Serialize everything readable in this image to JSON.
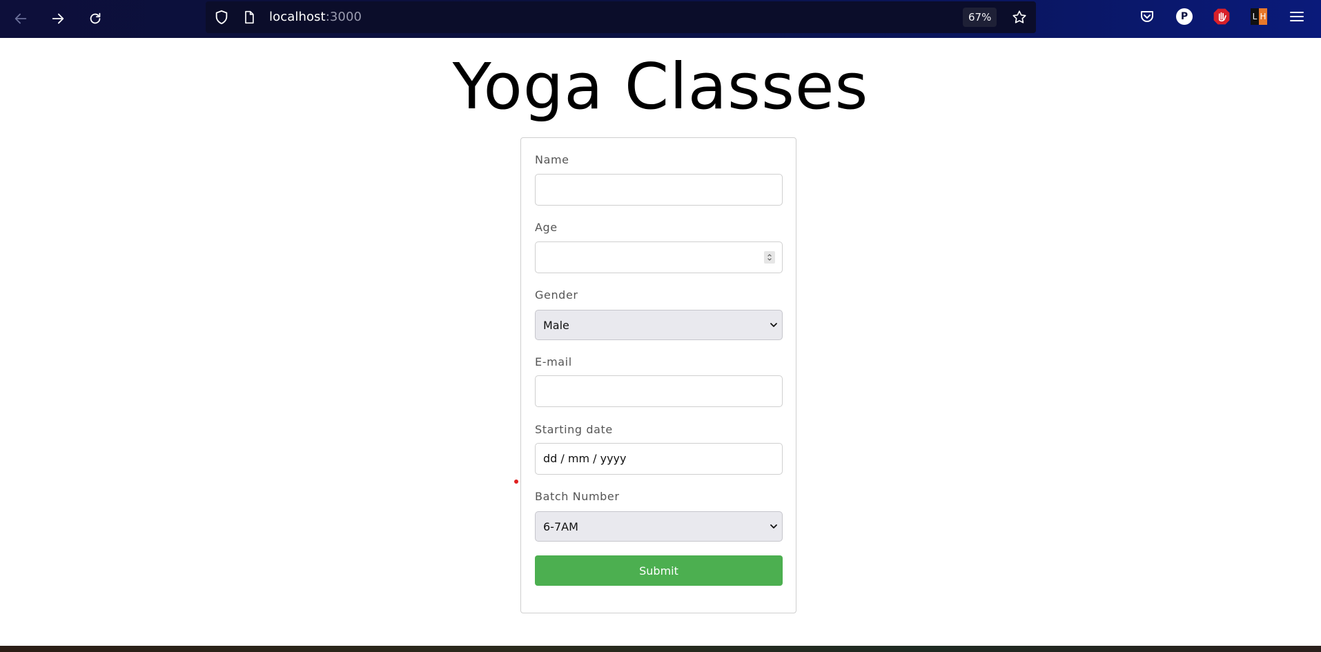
{
  "browser": {
    "url_host": "localhost",
    "url_port": ":3000",
    "zoom": "67%",
    "icons": {
      "back": "back-arrow-icon",
      "forward": "forward-arrow-icon",
      "reload": "reload-icon",
      "shield": "shield-icon",
      "page": "page-icon",
      "bookmark": "star-icon",
      "pocket": "pocket-icon",
      "profile": "profile-p-icon",
      "ublock": "ublock-icon",
      "lighthouse": "lighthouse-icon",
      "menu": "hamburger-menu-icon"
    },
    "profile_letter": "P",
    "lh_text_l": "L",
    "lh_text_h": "H"
  },
  "page": {
    "title": "Yoga Classes"
  },
  "form": {
    "name_label": "Name",
    "name_value": "",
    "age_label": "Age",
    "age_value": "",
    "gender_label": "Gender",
    "gender_value": "Male",
    "email_label": "E-mail",
    "email_value": "",
    "date_label": "Starting date",
    "date_placeholder": "dd / mm / yyyy",
    "batch_label": "Batch Number",
    "batch_value": "6-7AM",
    "submit_label": "Submit"
  },
  "colors": {
    "submit_green": "#4caf50",
    "toolbar_bg": "#0b1140"
  }
}
